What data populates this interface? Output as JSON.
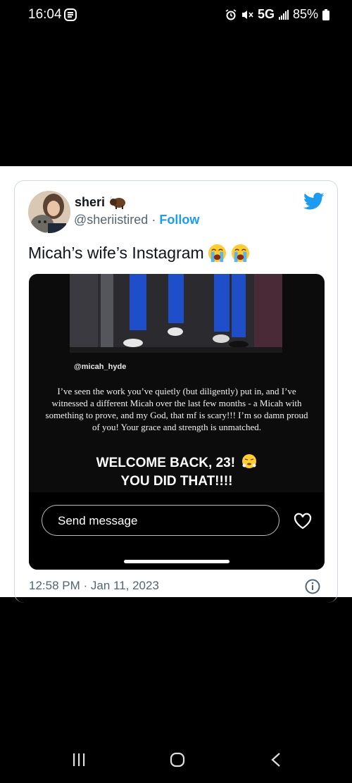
{
  "status_bar": {
    "time": "16:04",
    "network": "5G",
    "battery": "85%"
  },
  "tweet": {
    "author_name": "sheri",
    "author_handle": "@sheriistired",
    "separator": "·",
    "follow_label": "Follow",
    "text": "Micah’s wife’s Instagram",
    "text_emoji": [
      "loudly-crying-face-emoji",
      "loudly-crying-face-emoji"
    ],
    "timestamp": "12:58 PM · Jan 11, 2023"
  },
  "story": {
    "mention": "@micah_hyde",
    "message": "I’ve seen the work you’ve quietly (but diligently) put in, and I’ve witnessed a different Micah over the last few months - a Micah with something to prove, and my God, that mf is scary!!! I’m so damn proud of you! Your grace and strength is unmatched.",
    "welcome_line1": "WELCOME BACK, 23!",
    "welcome_line2": "YOU DID THAT!!!!",
    "send_placeholder": "Send message"
  },
  "colors": {
    "twitter_blue": "#1d9bf0",
    "handle_gray": "#536471",
    "tweet_text": "#0f1419"
  },
  "icons": [
    "alarm-icon",
    "mute-icon",
    "signal-icon",
    "battery-icon",
    "bison-icon",
    "twitter-logo-icon",
    "heart-icon",
    "info-icon",
    "recents-icon",
    "home-icon",
    "back-icon"
  ]
}
